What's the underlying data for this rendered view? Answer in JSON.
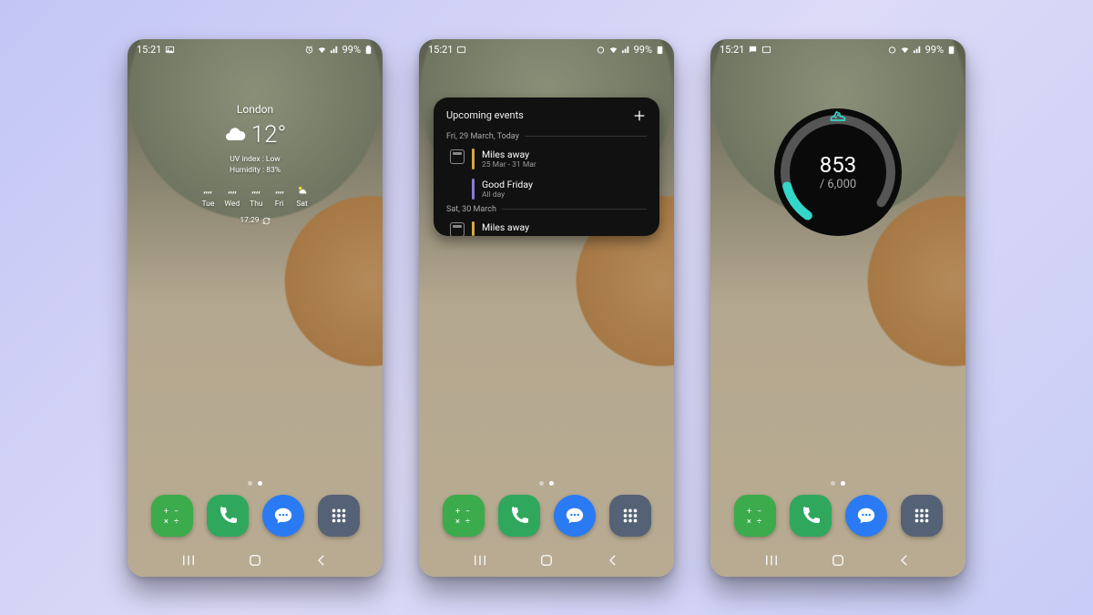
{
  "status": {
    "time": "15:21",
    "battery": "99%"
  },
  "weather": {
    "city": "London",
    "temp": "12°",
    "uv": "UV index : Low",
    "humidity": "Humidity : 83%",
    "forecast": [
      {
        "day": "Tue"
      },
      {
        "day": "Wed"
      },
      {
        "day": "Thu"
      },
      {
        "day": "Fri"
      },
      {
        "day": "Sat"
      }
    ],
    "updated": "17:29"
  },
  "calendar": {
    "title": "Upcoming events",
    "sections": [
      {
        "date": "Fri, 29 March, Today",
        "events": [
          {
            "title": "Miles away",
            "sub": "25 Mar - 31 Mar",
            "color": "y"
          },
          {
            "title": "Good Friday",
            "sub": "All day",
            "color": "p"
          }
        ]
      },
      {
        "date": "Sat, 30 March",
        "events": [
          {
            "title": "Miles away",
            "sub": "",
            "color": "y"
          }
        ]
      }
    ]
  },
  "steps": {
    "current": "853",
    "goal": "/ 6,000"
  },
  "dock": [
    "calculator",
    "phone",
    "messages",
    "apps"
  ]
}
